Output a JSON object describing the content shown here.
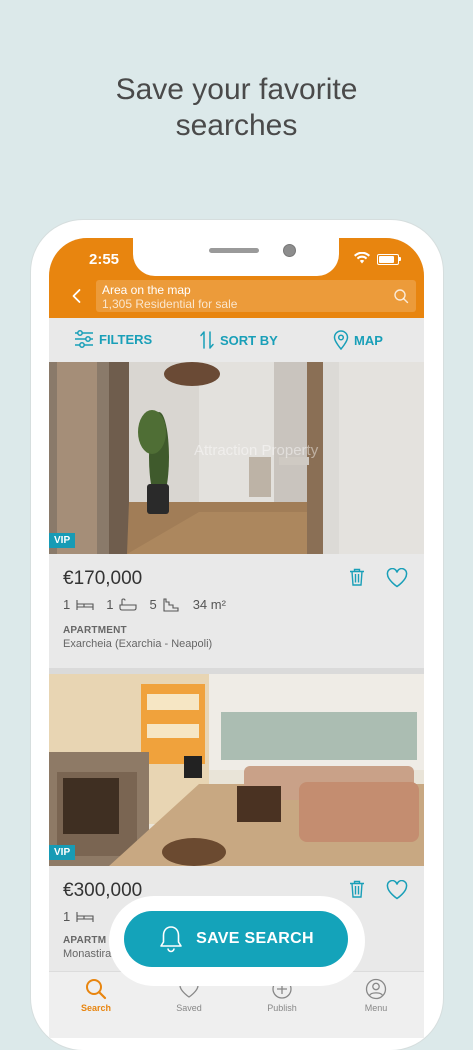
{
  "headline": {
    "line1": "Save your favorite",
    "line2": "searches"
  },
  "status": {
    "time": "2:55"
  },
  "search": {
    "title": "Area on the map",
    "subtitle": "1,305 Residential for sale"
  },
  "toolbar": {
    "filters": "FILTERS",
    "sort": "SORT BY",
    "map": "MAP"
  },
  "listings": [
    {
      "badge": "VIP",
      "price": "€170,000",
      "rooms": "1",
      "baths": "1",
      "floor": "5",
      "area": "34 m²",
      "type": "APARTMENT",
      "location": "Exarcheia (Exarchia - Neapoli)",
      "watermark": "Attraction Property"
    },
    {
      "badge": "VIP",
      "price": "€300,000",
      "rooms": "1",
      "type": "APARTM",
      "location": "Monastira"
    }
  ],
  "save_button": {
    "label": "SAVE SEARCH"
  },
  "nav": [
    {
      "label": "Search",
      "active": true
    },
    {
      "label": "Saved"
    },
    {
      "label": "Publish"
    },
    {
      "label": "Menu"
    }
  ],
  "colors": {
    "brand_orange": "#e8850f",
    "accent_teal": "#14a3ba",
    "background": "#dce9ea"
  }
}
